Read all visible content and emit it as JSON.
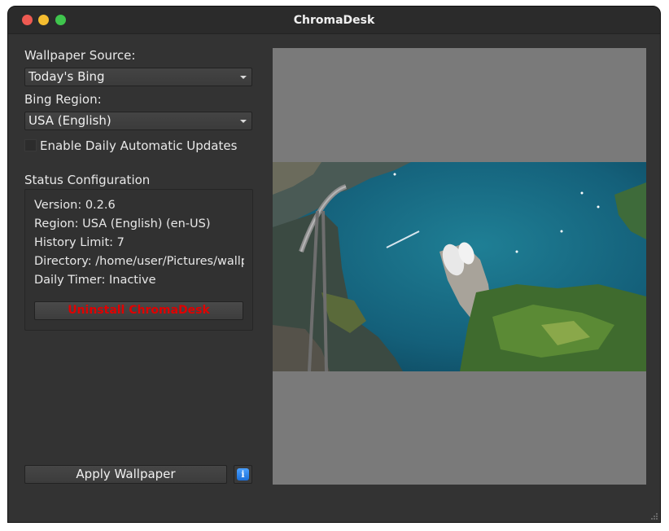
{
  "window": {
    "title": "ChromaDesk",
    "buttons": [
      "close",
      "minimize",
      "maximize"
    ]
  },
  "form": {
    "source_label": "Wallpaper Source:",
    "source_value": "Today's Bing",
    "region_label": "Bing Region:",
    "region_value": "USA (English)",
    "auto_update_label": "Enable Daily Automatic Updates",
    "auto_update_checked": false
  },
  "status": {
    "title": "Status Configuration",
    "version": "Version: 0.2.6",
    "region": "Region: USA (English) (en-US)",
    "history": "History Limit: 7",
    "directory": "Directory: /home/user/Pictures/wallpa",
    "timer": "Daily Timer: Inactive",
    "uninstall_label": "Uninstall ChromaDesk"
  },
  "actions": {
    "apply_label": "Apply Wallpaper",
    "info_icon": "i"
  },
  "preview": {
    "description_icon": "wallpaper-preview-image"
  },
  "colors": {
    "background": "#333333",
    "uninstall_text": "#e00000",
    "info_accent": "#2a86f0",
    "preview_bg": "#7a7a7a"
  }
}
